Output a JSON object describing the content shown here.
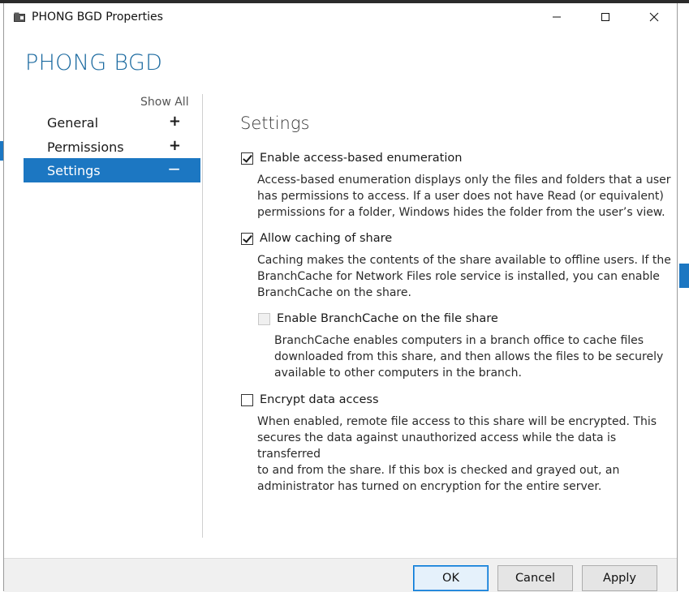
{
  "window": {
    "title": "PHONG BGD Properties",
    "heading": "PHONG BGD"
  },
  "nav": {
    "show_all": "Show All",
    "items": [
      {
        "label": "General",
        "symbol": "+"
      },
      {
        "label": "Permissions",
        "symbol": "+"
      },
      {
        "label": "Settings",
        "symbol": "−"
      }
    ]
  },
  "settings": {
    "title": "Settings",
    "options": [
      {
        "label": "Enable access-based enumeration",
        "checked": true,
        "description": [
          "Access-based enumeration displays only the files and folders that a user",
          "has permissions to access. If a user does not have Read (or equivalent)",
          "permissions for a folder, Windows hides the folder from the user’s view."
        ]
      },
      {
        "label": "Allow caching of share",
        "checked": true,
        "description": [
          "Caching makes the contents of the share available to offline users. If the",
          "BranchCache for Network Files role service is installed, you can enable",
          "BranchCache on the share."
        ]
      },
      {
        "label": "Enable BranchCache on the file share",
        "checked": false,
        "disabled": true,
        "description": [
          "BranchCache enables computers in a branch office to cache files",
          "downloaded from this share, and then allows the files to be securely",
          "available to other computers in the branch."
        ]
      },
      {
        "label": "Encrypt data access",
        "checked": false,
        "description": [
          "When enabled, remote file access to this share will be encrypted. This",
          "secures the data against unauthorized access while the data is transferred",
          "to and from the share. If this box is checked and grayed out, an",
          "administrator has turned on encryption for the entire server."
        ]
      }
    ]
  },
  "buttons": {
    "ok": "OK",
    "cancel": "Cancel",
    "apply": "Apply"
  },
  "colors": {
    "accent": "#1c77c2",
    "heading": "#1b6aa0"
  }
}
